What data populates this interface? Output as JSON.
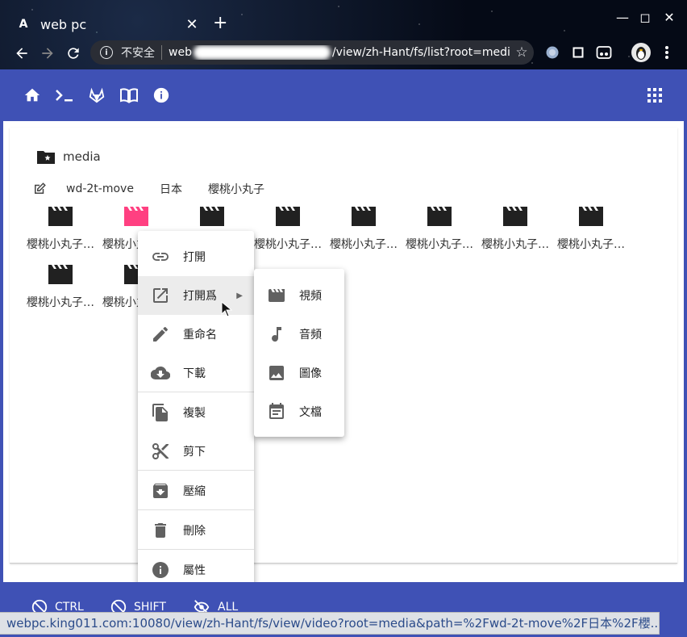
{
  "browser": {
    "tab_title": "web pc",
    "tab_favicon": "A",
    "insecure_label": "不安全",
    "url_prefix": "web",
    "url_tail": "/view/zh-Hant/fs/list?root=media&...",
    "status_url": "webpc.king011.com:10080/view/zh-Hant/fs/view/video?root=media&path=%2Fwd-2t-move%2F日本%2F櫻..."
  },
  "appbar": {
    "icons": [
      "home-icon",
      "terminal-icon",
      "gitlab-icon",
      "book-icon",
      "info-icon"
    ],
    "right_icon": "apps-grid-icon"
  },
  "breadcrumb": {
    "root_label": "media",
    "segments": [
      "wd-2t-move",
      "日本",
      "櫻桃小丸子"
    ]
  },
  "files": [
    {
      "name": "櫻桃小丸子…",
      "color": "#212121"
    },
    {
      "name": "櫻桃小丸子…",
      "color": "#ff4081"
    },
    {
      "name": "櫻桃小丸子…",
      "color": "#212121"
    },
    {
      "name": "櫻桃小丸子…",
      "color": "#212121"
    },
    {
      "name": "櫻桃小丸子…",
      "color": "#212121"
    },
    {
      "name": "櫻桃小丸子…",
      "color": "#212121"
    },
    {
      "name": "櫻桃小丸子…",
      "color": "#212121"
    },
    {
      "name": "櫻桃小丸子…",
      "color": "#212121"
    },
    {
      "name": "櫻桃小丸子…",
      "color": "#212121"
    },
    {
      "name": "櫻桃小丸子…",
      "color": "#212121"
    }
  ],
  "context_menu": {
    "items": [
      "打開",
      "打開爲",
      "重命名",
      "下載",
      "複製",
      "剪下",
      "壓縮",
      "刪除",
      "屬性"
    ]
  },
  "submenu": {
    "items": [
      "視頻",
      "音頻",
      "圖像",
      "文檔"
    ]
  },
  "bottombar": {
    "items": [
      "CTRL",
      "SHIFT",
      "ALL"
    ]
  },
  "colors": {
    "primary": "#3f51b5",
    "accent": "#ff4081",
    "icon": "#616161"
  }
}
